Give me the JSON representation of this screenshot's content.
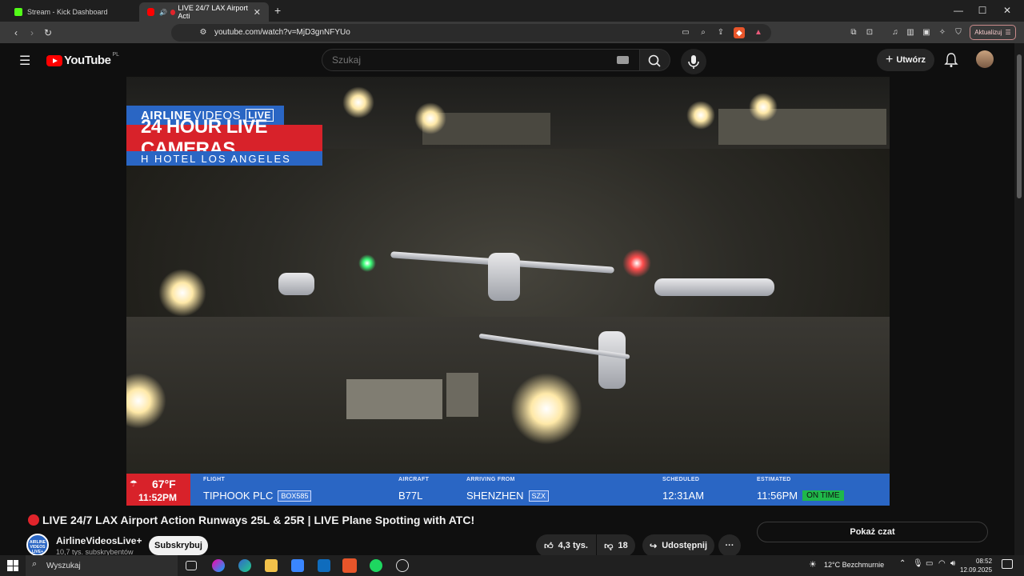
{
  "browser": {
    "tabs": [
      {
        "label": "Stream - Kick Dashboard",
        "active": false
      },
      {
        "label": "LIVE 24/7 LAX Airport Acti",
        "active": true
      }
    ],
    "new_tab": "+",
    "window_controls": {
      "minimize": "—",
      "maximize": "☐",
      "close": "✕"
    },
    "url": "youtube.com/watch?v=MjD3gnNFYUo",
    "update_label": "Aktualizuj"
  },
  "youtube": {
    "logo_text": "YouTube",
    "country_code": "PL",
    "search_placeholder": "Szukaj",
    "create_label": "Utwórz"
  },
  "video": {
    "brand_airline": "AIRLINE",
    "brand_videos": "VIDEOS",
    "brand_live": "LIVE",
    "cam_title": "24 HOUR LIVE CAMERAS",
    "hotel": "H HOTEL LOS ANGELES",
    "flightbar": {
      "temperature": "67°F",
      "time": "11:52PM",
      "labels": {
        "flight": "FLIGHT",
        "aircraft": "AIRCRAFT",
        "arriving": "ARRIVING FROM",
        "scheduled": "SCHEDULED",
        "estimated": "ESTIMATED"
      },
      "flight": "TIPHOOK PLC",
      "flight_code": "BOX585",
      "aircraft": "B77L",
      "arriving": "SHENZHEN",
      "arriving_code": "SZX",
      "scheduled": "12:31AM",
      "estimated": "11:56PM",
      "status": "ON TIME"
    }
  },
  "page": {
    "title": "LIVE 24/7 LAX Airport Action Runways 25L & 25R | LIVE Plane Spotting with ATC!",
    "channel_name": "AirlineVideosLive+",
    "channel_subs": "10,7 tys. subskrybentów",
    "subscribe_label": "Subskrybuj",
    "likes": "4,3 tys.",
    "dislikes": "18",
    "share_label": "Udostępnij",
    "more_label": "···",
    "chat_label": "Pokaż czat"
  },
  "taskbar": {
    "search_placeholder": "Wyszukaj",
    "weather": "12°C  Bezchmurnie",
    "clock_time": "08:52",
    "clock_date": "12.09.2025"
  },
  "colors": {
    "yt_red": "#ff0000",
    "brand_blue": "#2a66c4",
    "brand_red": "#d8222a",
    "ontime_green": "#1fb84a"
  }
}
